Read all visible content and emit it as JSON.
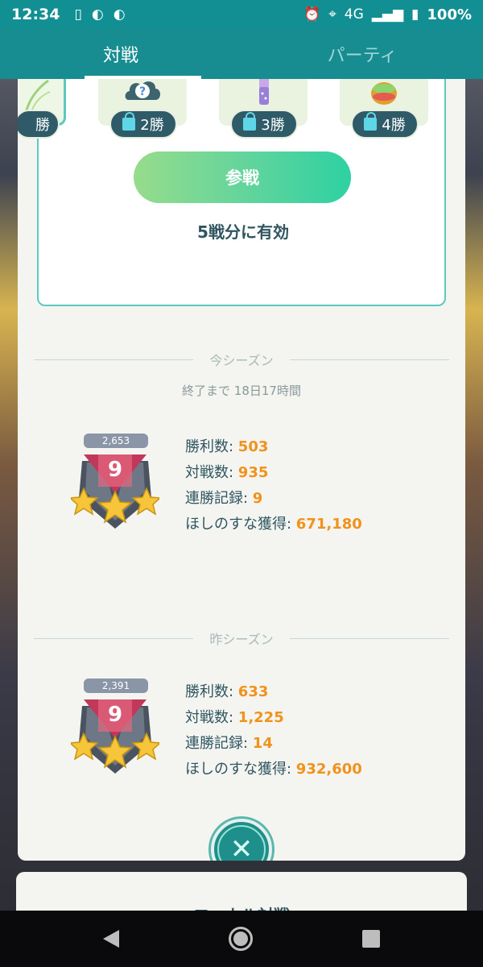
{
  "status_bar": {
    "time": "12:34",
    "network": "4G",
    "battery": "100%"
  },
  "tabs": [
    {
      "label": "対戦",
      "active": true
    },
    {
      "label": "パーティ",
      "active": false
    }
  ],
  "rewards": {
    "first_label": "勝",
    "items": [
      {
        "label": "2勝",
        "icon": "mystery-icon"
      },
      {
        "label": "3勝",
        "icon": "potion-icon"
      },
      {
        "label": "4勝",
        "icon": "orb-icon"
      }
    ],
    "join_label": "参戦",
    "valid_text": "5戦分に有効"
  },
  "current_season": {
    "heading": "今シーズン",
    "remaining": "終了まで 18日17時間",
    "rating": "2,653",
    "rank": "9",
    "stats": [
      {
        "label": "勝利数: ",
        "value": "503"
      },
      {
        "label": "対戦数: ",
        "value": "935"
      },
      {
        "label": "連勝記録: ",
        "value": "9"
      },
      {
        "label": "ほしのすな獲得: ",
        "value": "671,180"
      }
    ]
  },
  "last_season": {
    "heading": "昨シーズン",
    "rating": "2,391",
    "rank": "9",
    "stats": [
      {
        "label": "勝利数: ",
        "value": "633"
      },
      {
        "label": "対戦数: ",
        "value": "1,225"
      },
      {
        "label": "連勝記録: ",
        "value": "14"
      },
      {
        "label": "ほしのすな獲得: ",
        "value": "932,600"
      }
    ]
  },
  "next_card_title": "ローカル対戦",
  "colors": {
    "accent": "#178d92",
    "value_orange": "#f0921c",
    "text_dark": "#2f5561"
  }
}
